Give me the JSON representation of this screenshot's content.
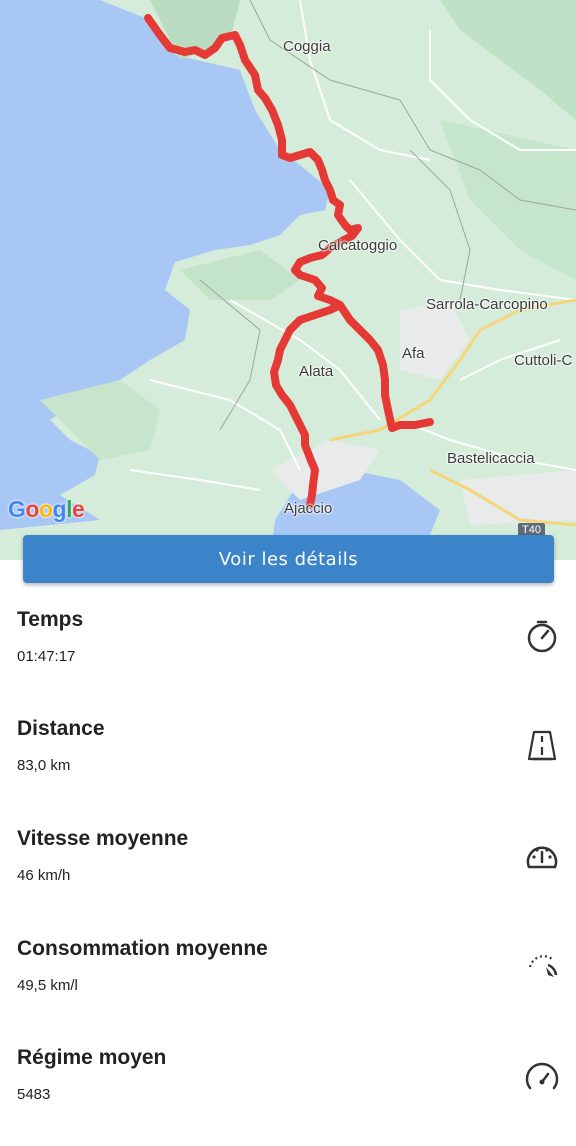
{
  "map": {
    "places": [
      "Coggia",
      "Calcatoggio",
      "Sarrola-Carcopino",
      "Afa",
      "Cuttoli-C",
      "Alata",
      "Bastelicaccia",
      "Ajaccio"
    ],
    "google_letters": [
      "G",
      "o",
      "o",
      "g",
      "l",
      "e"
    ],
    "road_badge": "T40",
    "colors": {
      "sea": "#a9c7f4",
      "land": "#d4ecd9",
      "route": "#e53935"
    }
  },
  "details_button": {
    "label": "Voir les détails",
    "color": "#3b84c9"
  },
  "stats": [
    {
      "label": "Temps",
      "value": "01:47:17",
      "icon": "stopwatch-icon"
    },
    {
      "label": "Distance",
      "value": "83,0 km",
      "icon": "road-icon"
    },
    {
      "label": "Vitesse moyenne",
      "value": "46 km/h",
      "icon": "speedometer-icon"
    },
    {
      "label": "Consommation moyenne",
      "value": "49,5 km/l",
      "icon": "gauge-needle-icon"
    },
    {
      "label": "Régime moyen",
      "value": "5483",
      "icon": "tachometer-icon"
    }
  ]
}
